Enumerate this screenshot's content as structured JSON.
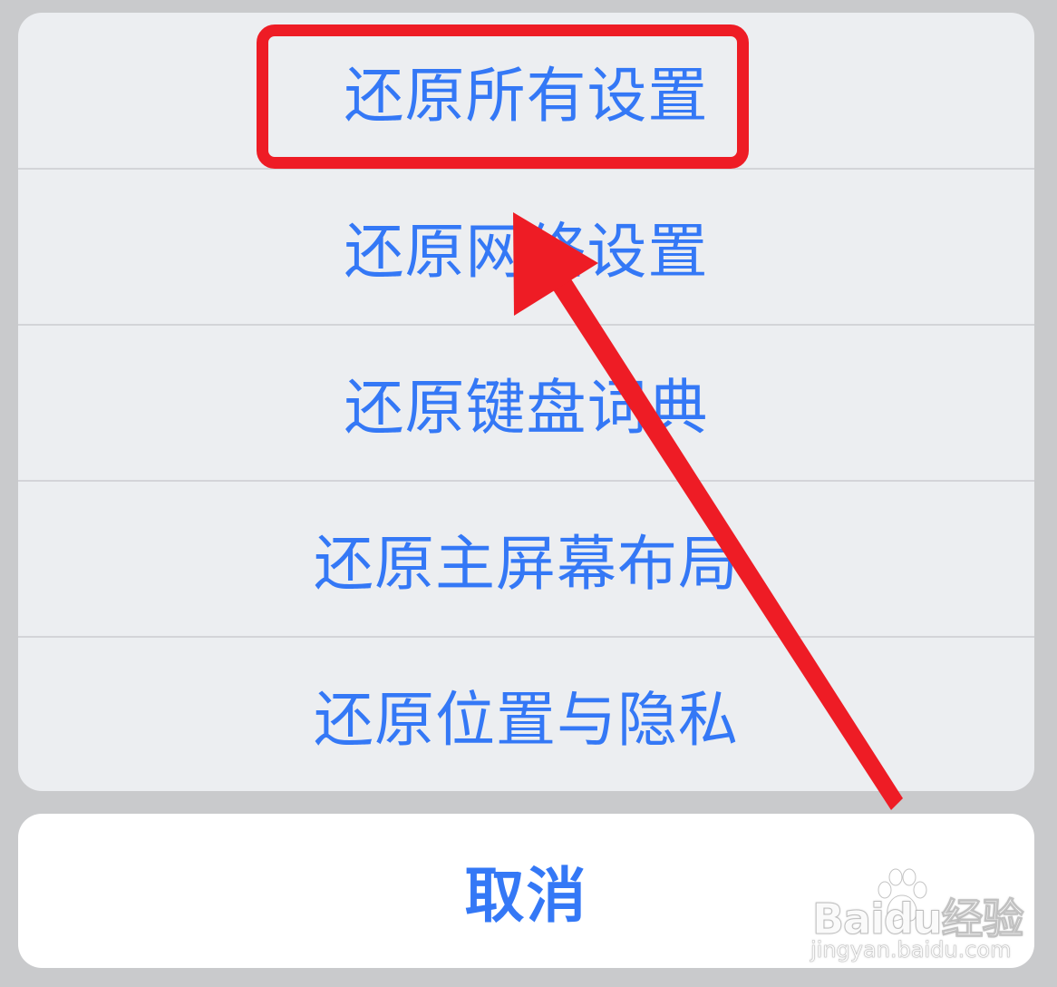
{
  "action_sheet": {
    "items": [
      {
        "label": "还原所有设置"
      },
      {
        "label": "还原网络设置"
      },
      {
        "label": "还原键盘词典"
      },
      {
        "label": "还原主屏幕布局"
      },
      {
        "label": "还原位置与隐私"
      }
    ],
    "cancel_label": "取消"
  },
  "annotation": {
    "highlight_color": "#ee1c25",
    "arrow_color": "#ee1c25",
    "highlighted_item": "还原所有设置"
  },
  "watermark": {
    "brand": "Baidu经验",
    "url": "jingyan.baidu.com"
  },
  "colors": {
    "accent": "#3478f6",
    "sheet_background": "#eceef1",
    "cancel_background": "#ffffff",
    "dim_background": "#c9cacc"
  }
}
